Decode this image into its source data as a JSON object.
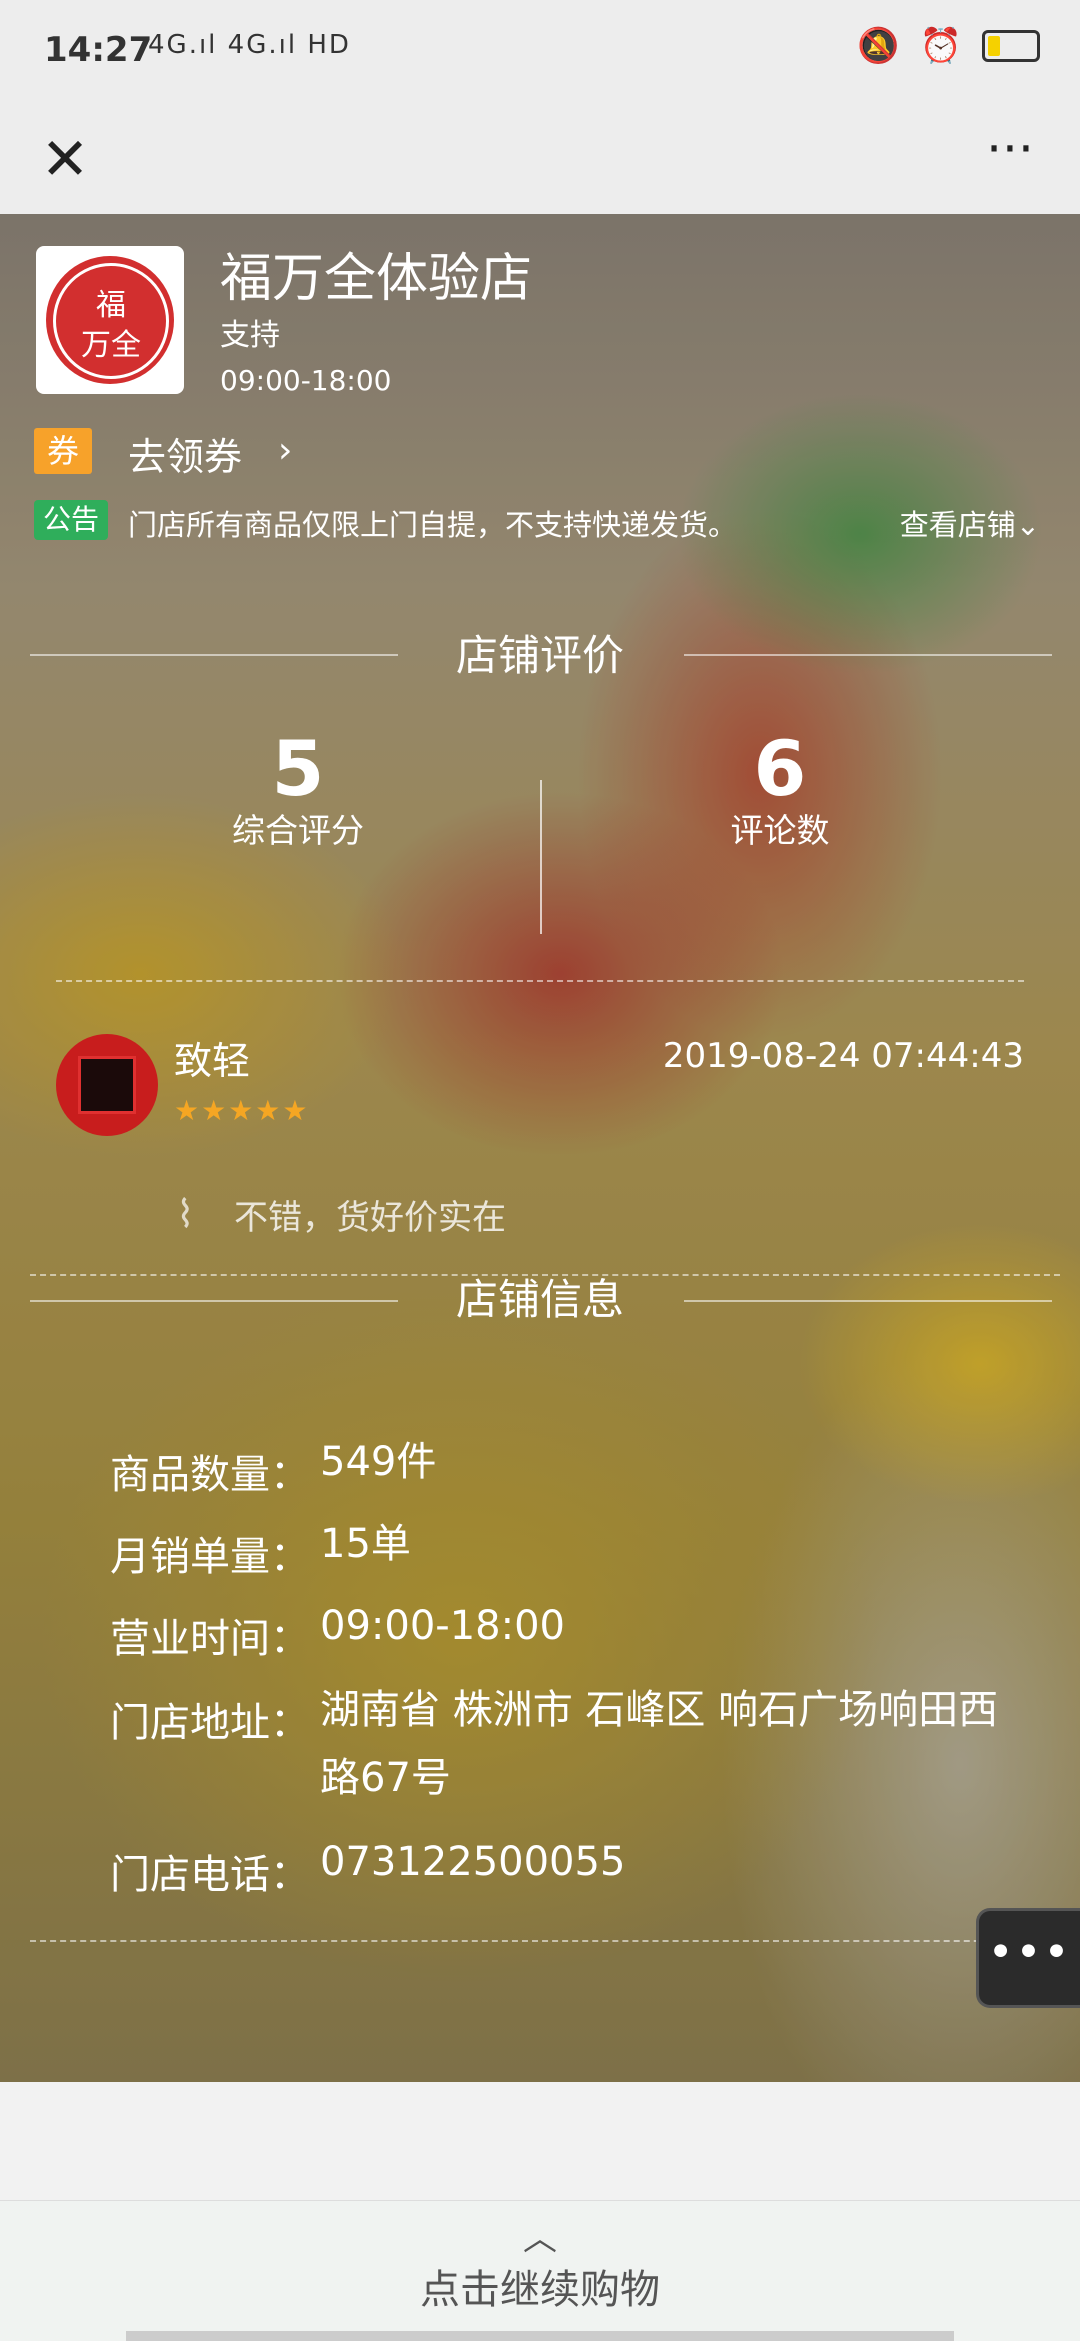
{
  "status_bar": {
    "time": "14:27",
    "signal": "4G.ıl 4G.ıl",
    "wifi": "HD",
    "icons": [
      "mute-icon",
      "alarm-icon",
      "battery-icon"
    ],
    "battery_color": "#f5d100"
  },
  "nav": {
    "close_icon": "✕",
    "more_icon": "···"
  },
  "store": {
    "logo_line1": "福",
    "logo_line2": "万全",
    "name": "福万全体验店",
    "support": "支持",
    "hours": "09:00-18:00",
    "coupon_badge": "券",
    "coupon_text": "去领券",
    "coupon_arrow": "›",
    "notice_badge": "公告",
    "notice_text": "门店所有商品仅限上门自提，不支持快递发货。",
    "view_store": "查看店铺⌄"
  },
  "rating": {
    "section_title": "店铺评价",
    "overall_score": "5",
    "overall_label": "综合评分",
    "review_count": "6",
    "review_count_label": "评论数"
  },
  "review": {
    "name": "致轻",
    "stars": "★★★★★",
    "rating": 5,
    "date": "2019-08-24 07:44:43",
    "icon": "⌇",
    "text": "不错，货好价实在"
  },
  "info": {
    "section_title": "店铺信息",
    "rows": [
      {
        "label": "商品数量：",
        "value": "549件"
      },
      {
        "label": "月销单量：",
        "value": "15单"
      },
      {
        "label": "营业时间：",
        "value": "09:00-18:00"
      },
      {
        "label": "门店地址：",
        "value": "湖南省 株洲市 石峰区 响石广场响田西路67号"
      },
      {
        "label": "门店电话：",
        "value": "073122500055"
      }
    ]
  },
  "float_button": "•••",
  "bottom": {
    "chevron": "︿",
    "label": "点击继续购物"
  }
}
